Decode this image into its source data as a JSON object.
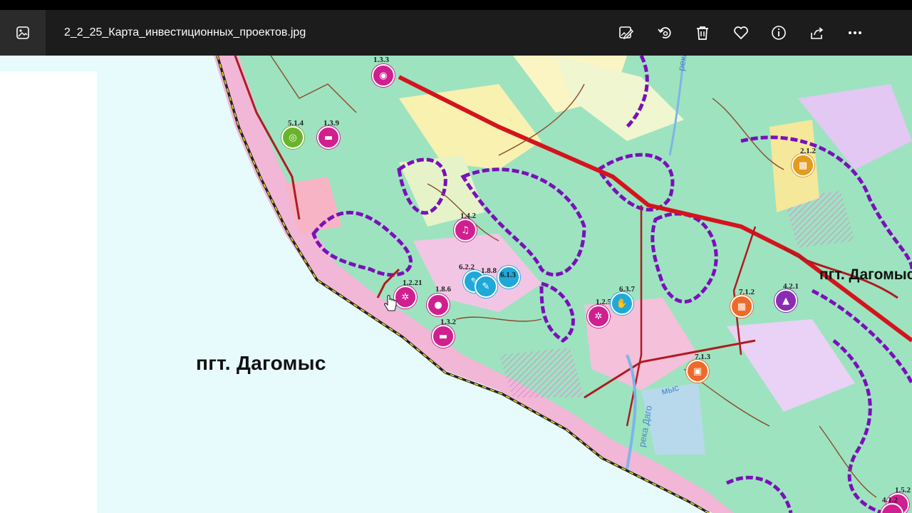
{
  "window": {
    "filename": "2_2_25_Карта_инвестиционных_проектов.jpg"
  },
  "toolbar": {
    "buttons": [
      "edit-image",
      "rotate",
      "delete",
      "favorite",
      "info",
      "share",
      "more"
    ]
  },
  "map": {
    "labels": {
      "town_main": "пгт. Дагомыс",
      "town_secondary": "пгт. Дагомыс",
      "river_1": "река За",
      "river_2": "река Даго",
      "river_3": "мыс"
    },
    "markers": [
      {
        "code": "1.3.3",
        "color": "#d01f8f",
        "icon": "camera-icon"
      },
      {
        "code": "5.1.4",
        "color": "#6ab42d",
        "icon": "target-icon"
      },
      {
        "code": "1.3.9",
        "color": "#d01f8f",
        "icon": "bed-icon"
      },
      {
        "code": "1.4.2",
        "color": "#d01f8f",
        "icon": "music-icon"
      },
      {
        "code": "6.2.2",
        "color": "#1fa8d8",
        "icon": "leaf-icon"
      },
      {
        "code": "1.8.8",
        "color": "#1fa8d8",
        "icon": "leaf-icon"
      },
      {
        "code": "6.1.3",
        "color": "#1fa8d8",
        "icon": "none"
      },
      {
        "code": "1.2.21",
        "color": "#d01f8f",
        "icon": "wheel-icon"
      },
      {
        "code": "1.8.6",
        "color": "#d01f8f",
        "icon": "pin-icon"
      },
      {
        "code": "1.3.2",
        "color": "#d01f8f",
        "icon": "bed-icon"
      },
      {
        "code": "1.2.5",
        "color": "#d01f8f",
        "icon": "wheel-icon"
      },
      {
        "code": "6.3.7",
        "color": "#1fa8d8",
        "icon": "hand-icon"
      },
      {
        "code": "7.1.2",
        "color": "#ee6a2a",
        "icon": "building-icon"
      },
      {
        "code": "4.2.1",
        "color": "#8a2bb3",
        "icon": "graduation-icon"
      },
      {
        "code": "2.1.2",
        "color": "#e39a1d",
        "icon": "grid-icon"
      },
      {
        "code": "7.1.3",
        "color": "#ee6a2a",
        "icon": "car-icon"
      },
      {
        "code": "1.5.2",
        "color": "#d01f8f",
        "icon": "none"
      },
      {
        "code": "4.1.2",
        "color": "#d01f8f",
        "icon": "none"
      }
    ]
  }
}
